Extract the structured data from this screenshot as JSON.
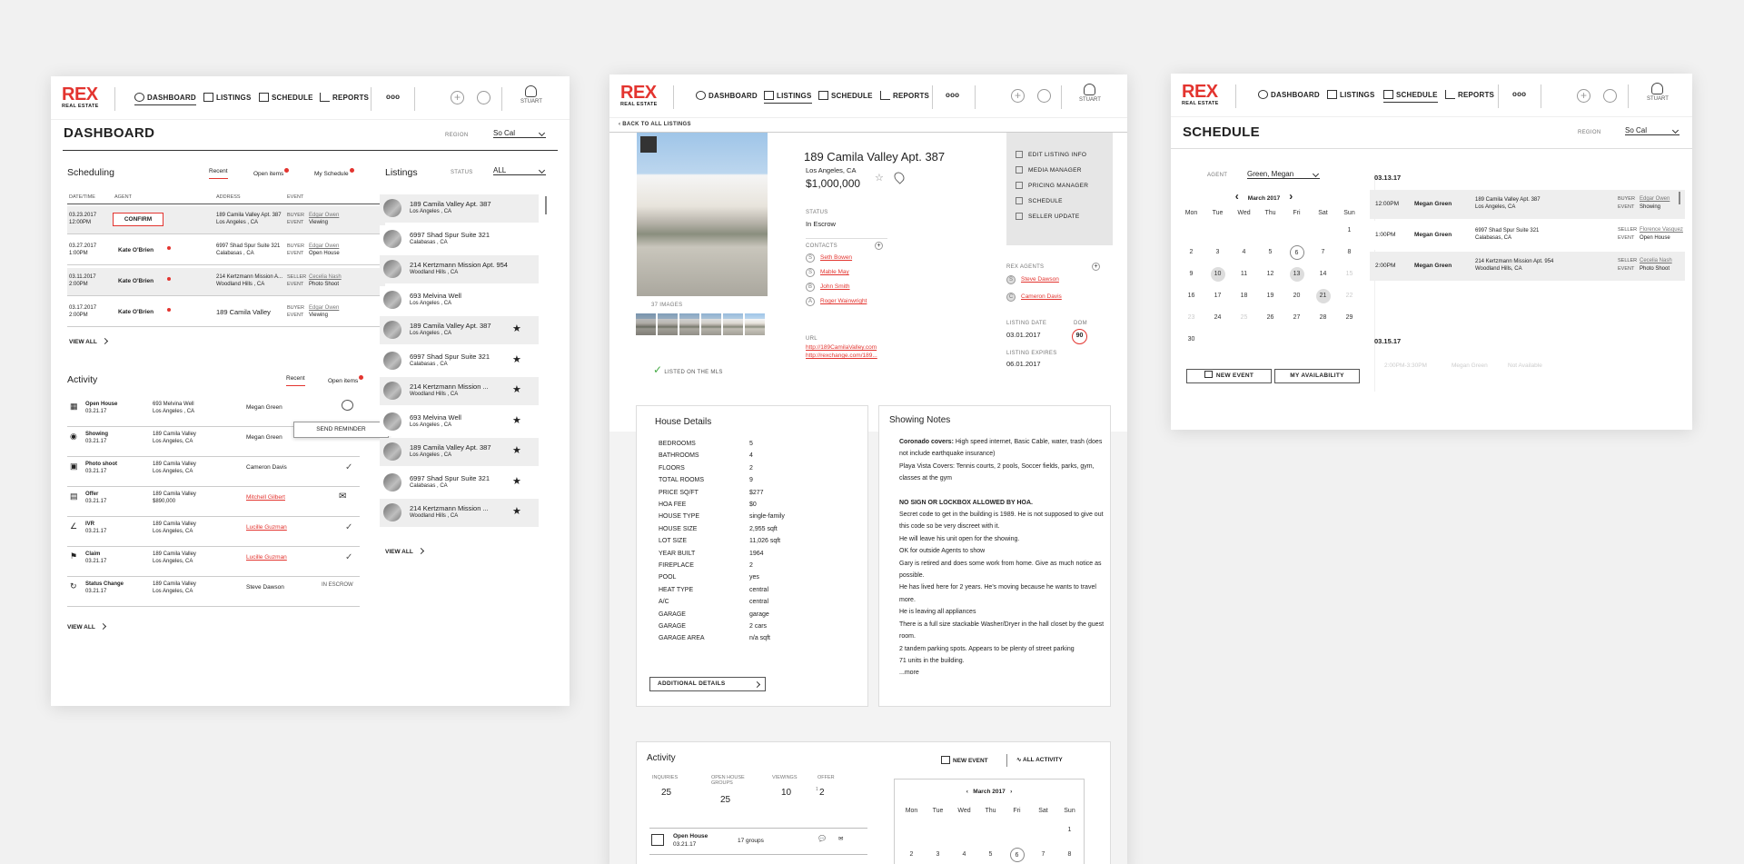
{
  "nav": {
    "logo_main": "REX",
    "logo_sub": "REAL ESTATE",
    "dashboard": "DASHBOARD",
    "listings": "LISTINGS",
    "schedule": "SCHEDULE",
    "reports": "REPORTS",
    "more": "ooo",
    "plus": "+",
    "user": "STUART"
  },
  "colors": {
    "accent": "#e3342f",
    "bg": "#f1f1f1"
  },
  "dashboard": {
    "title": "DASHBOARD",
    "region_label": "REGION",
    "region_value": "So Cal",
    "scheduling": {
      "title": "Scheduling",
      "tabs": [
        "Recent",
        "Open items",
        "My Schedule"
      ],
      "cols": [
        "DATE/TIME",
        "AGENT",
        "ADDRESS",
        "EVENT"
      ],
      "rows": [
        {
          "date": "03.23.2017",
          "time": "12:00PM",
          "agent": "CONFIRM",
          "addr1": "189 Camila Valley Apt. 387",
          "addr2": "Los Angeles , CA",
          "role1": "BUYER",
          "name": "Edgar Owen",
          "role2": "EVENT",
          "event": "Viewing"
        },
        {
          "date": "03.27.2017",
          "time": "1:00PM",
          "agent": "Kate O'Brien",
          "addr1": "6997 Shad Spur Suite 321",
          "addr2": "Calabasas , CA",
          "role1": "BUYER",
          "name": "Edgar Owen",
          "role2": "EVENT",
          "event": "Open House"
        },
        {
          "date": "03.11.2017",
          "time": "2:00PM",
          "agent": "Kate O'Brien",
          "addr1": "214 Kertzmann Mission A...",
          "addr2": "Woodland Hills , CA",
          "role1": "SELLER",
          "name": "Cecelia Nash",
          "role2": "EVENT",
          "event": "Photo Shoot"
        },
        {
          "date": "03.17.2017",
          "time": "2:00PM",
          "agent": "Kate O'Brien",
          "addr1": "189 Camila Valley",
          "addr2": "",
          "role1": "BUYER",
          "name": "Edgar Owen",
          "role2": "EVENT",
          "event": "Viewing"
        }
      ],
      "view_all": "VIEW ALL"
    },
    "activity": {
      "title": "Activity",
      "tabs": [
        "Recent",
        "Open items"
      ],
      "rows": [
        {
          "type": "Open House",
          "date": "03.21.17",
          "addr1": "693 Melvina Well",
          "addr2": "Los Angeles , CA",
          "person": "Megan Green",
          "status": ""
        },
        {
          "type": "Showing",
          "date": "03.21.17",
          "addr1": "189 Camila Valley",
          "addr2": "Los Angeles, CA",
          "person": "Megan Green",
          "status": ""
        },
        {
          "type": "Photo shoot",
          "date": "03.21.17",
          "addr1": "189 Camila Valley",
          "addr2": "Los Angeles, CA",
          "person": "Cameron Davis",
          "status": "✓"
        },
        {
          "type": "Offer",
          "date": "03.21.17",
          "addr1": "189 Camila Valley",
          "addr2": "$890,000",
          "person": "Mitchell Gilbert",
          "status": ""
        },
        {
          "type": "IVR",
          "date": "03.21.17",
          "addr1": "189 Camila Valley",
          "addr2": "Los Angeles, CA",
          "person": "Lucille Guzman",
          "status": "✓"
        },
        {
          "type": "Claim",
          "date": "03.21.17",
          "addr1": "189 Camila Valley",
          "addr2": "Los Angeles, CA",
          "person": "Lucille Guzman",
          "status": "✓"
        },
        {
          "type": "Status Change",
          "date": "03.21.17",
          "addr1": "189 Camila Valley",
          "addr2": "Los Angeles, CA",
          "person": "Steve Dawson",
          "status": "IN ESCROW"
        }
      ],
      "send_reminder": "SEND REMINDER",
      "view_all": "VIEW ALL"
    },
    "listings": {
      "title": "Listings",
      "status_label": "STATUS",
      "status_value": "ALL",
      "view_all": "VIEW ALL",
      "items": [
        {
          "a": "189 Camila Valley Apt. 387",
          "b": "Los Angeles , CA"
        },
        {
          "a": "6997 Shad Spur Suite 321",
          "b": "Calabasas , CA"
        },
        {
          "a": "214 Kertzmann Mission Apt. 954",
          "b": "Woodland Hills , CA"
        },
        {
          "a": "693 Melvina Well",
          "b": "Los Angeles , CA"
        },
        {
          "a": "189 Camila Valley Apt. 387",
          "b": "Los Angeles , CA"
        },
        {
          "a": "6997 Shad Spur Suite 321",
          "b": "Calabasas , CA"
        },
        {
          "a": "214 Kertzmann Mission ...",
          "b": "Woodland Hills , CA"
        },
        {
          "a": "693 Melvina Well",
          "b": "Los Angeles , CA"
        },
        {
          "a": "189 Camila Valley Apt. 387",
          "b": "Los Angeles , CA"
        },
        {
          "a": "6997 Shad Spur Suite 321",
          "b": "Calabasas , CA"
        },
        {
          "a": "214 Kertzmann Mission ...",
          "b": "Woodland Hills , CA"
        }
      ]
    }
  },
  "listing": {
    "back": "BACK TO ALL LISTINGS",
    "images": "37 IMAGES",
    "mls": "LISTED ON THE MLS",
    "title": "189 Camila Valley Apt. 387",
    "city": "Los Angeles, CA",
    "price": "$1,000,000",
    "status_label": "STATUS",
    "status": "In Escrow",
    "contacts_label": "CONTACTS",
    "contacts": [
      {
        "k": "S",
        "n": "Seth Bowen"
      },
      {
        "k": "S",
        "n": "Mable May"
      },
      {
        "k": "B",
        "n": "John Smith"
      },
      {
        "k": "A",
        "n": "Roger Wainwright"
      }
    ],
    "url_label": "URL",
    "url1": "http://189CamilaValley.com",
    "url2": "http://rexchange.com/189...",
    "menu": [
      "EDIT LISTING INFO",
      "MEDIA MANAGER",
      "PRICING MANAGER",
      "SCHEDULE",
      "SELLER UPDATE"
    ],
    "agents_label": "REX AGENTS",
    "agents": [
      {
        "k": "S",
        "n": "Steve Dawson"
      },
      {
        "k": "C",
        "n": "Cameron Davis"
      }
    ],
    "listing_date_label": "LISTING DATE",
    "listing_date": "03.01.2017",
    "dom_label": "DOM",
    "dom": "90",
    "expires_label": "LISTING EXPIRES",
    "expires": "06.01.2017",
    "house_details": {
      "title": "House Details",
      "items": [
        [
          "BEDROOMS",
          "5"
        ],
        [
          "BATHROOMS",
          "4"
        ],
        [
          "FLOORS",
          "2"
        ],
        [
          "TOTAL ROOMS",
          "9"
        ],
        [
          "PRICE SQ/FT",
          "$277"
        ],
        [
          "HOA FEE",
          "$0"
        ],
        [
          "HOUSE TYPE",
          "single-family"
        ],
        [
          "HOUSE SIZE",
          "2,955 sqft"
        ],
        [
          "LOT SIZE",
          "11,026 sqft"
        ],
        [
          "YEAR BUILT",
          "1964"
        ],
        [
          "FIREPLACE",
          "2"
        ],
        [
          "POOL",
          "yes"
        ],
        [
          "HEAT TYPE",
          "central"
        ],
        [
          "A/C",
          "central"
        ],
        [
          "GARAGE",
          "garage"
        ],
        [
          "GARAGE",
          "2 cars"
        ],
        [
          "GARAGE AREA",
          "n/a sqft"
        ]
      ],
      "additional": "ADDITIONAL DETAILS"
    },
    "notes": {
      "title": "Showing Notes",
      "lines": [
        {
          "b": "Coronado covers:",
          "t": " High speed internet, Basic Cable, water, trash (does not include earthquake insurance)"
        },
        {
          "b": "",
          "t": "Playa Vista Covers:  Tennis courts, 2 pools, Soccer fields, parks, gym, classes at the gym"
        },
        {
          "b": "NO SIGN OR LOCKBOX ALLOWED BY HOA.",
          "t": ""
        },
        {
          "b": "",
          "t": "Secret code to get in the building is 1989.  He is not supposed to give out this code so be very discreet with it."
        },
        {
          "b": "",
          "t": "He will leave his unit open for the showing."
        },
        {
          "b": "",
          "t": "OK for outside Agents to show"
        },
        {
          "b": "",
          "t": "Gary is retired and does some work from home.  Give as much notice as possible."
        },
        {
          "b": "",
          "t": "He has lived here for 2 years.  He's moving because he wants to travel more."
        },
        {
          "b": "",
          "t": "He is leaving all appliances"
        },
        {
          "b": "",
          "t": "There is a full size stackable Washer/Dryer in the hall closet by the guest room."
        },
        {
          "b": "",
          "t": "2 tandem parking spots.  Appears to be plenty of street parking"
        },
        {
          "b": "",
          "t": "71 units in the building."
        },
        {
          "b": "",
          "t": "...more"
        }
      ]
    },
    "activity": {
      "title": "Activity",
      "new_event": "NEW EVENT",
      "all_activity": "ALL ACTIVITY",
      "stats": [
        {
          "l": "INQUIRIES",
          "v": "25"
        },
        {
          "l": "OPEN HOUSE GROUPS",
          "v": "25"
        },
        {
          "l": "VIEWINGS",
          "v": "10"
        },
        {
          "l": "OFFER",
          "v": "2",
          "pre": "1"
        }
      ],
      "row": {
        "t": "Open House",
        "d": "03.21.17",
        "g": "17 groups"
      },
      "cal": {
        "month": "March 2017",
        "days": [
          "Mon",
          "Tue",
          "Wed",
          "Thu",
          "Fri",
          "Sat",
          "Sun"
        ],
        "w1": [
          "",
          "",
          "",
          "",
          "",
          "",
          "1"
        ],
        "w2": [
          "2",
          "3",
          "4",
          "5",
          "6",
          "7",
          "8"
        ]
      }
    }
  },
  "schedule": {
    "title": "SCHEDULE",
    "region_label": "REGION",
    "region_value": "So Cal",
    "agent_label": "AGENT",
    "agent_value": "Green, Megan",
    "month": "March 2017",
    "days": [
      "Mon",
      "Tue",
      "Wed",
      "Thu",
      "Fri",
      "Sat",
      "Sun"
    ],
    "weeks": [
      [
        "",
        "",
        "",
        "",
        "",
        "",
        "1"
      ],
      [
        "2",
        "3",
        "4",
        "5",
        "6",
        "7",
        "8"
      ],
      [
        "9",
        "10",
        "11",
        "12",
        "13",
        "14",
        "15"
      ],
      [
        "16",
        "17",
        "18",
        "19",
        "20",
        "21",
        "22"
      ],
      [
        "23",
        "24",
        "25",
        "26",
        "27",
        "28",
        "29"
      ],
      [
        "30",
        "",
        "",
        "",
        "",
        "",
        ""
      ]
    ],
    "new_event": "NEW EVENT",
    "availability": "MY AVAILABILITY",
    "date1": "03.13.17",
    "events": [
      {
        "time": "12:00PM",
        "agent": "Megan Green",
        "a": "189 Camila Valley Apt. 387",
        "b": "Los Angeles, CA",
        "r1": "BUYER",
        "n": "Edgar Owen",
        "r2": "EVENT",
        "e": "Showing"
      },
      {
        "time": "1:00PM",
        "agent": "Megan Green",
        "a": "6997 Shad Spur Suite 321",
        "b": "Calabasas, CA",
        "r1": "SELLER",
        "n": "Florence Vasquez",
        "r2": "EVENT",
        "e": "Open House"
      },
      {
        "time": "2:00PM",
        "agent": "Megan Green",
        "a": "214 Kertzmann Mission Apt. 954",
        "b": "Woodland Hills, CA",
        "r1": "SELLER",
        "n": "Cecelia Nash",
        "r2": "EVENT",
        "e": "Photo Shoot"
      }
    ],
    "date2": "03.15.17",
    "na_time": "2:00PM-3:30PM",
    "na_agent": "Megan Green",
    "na_text": "Not Available"
  }
}
